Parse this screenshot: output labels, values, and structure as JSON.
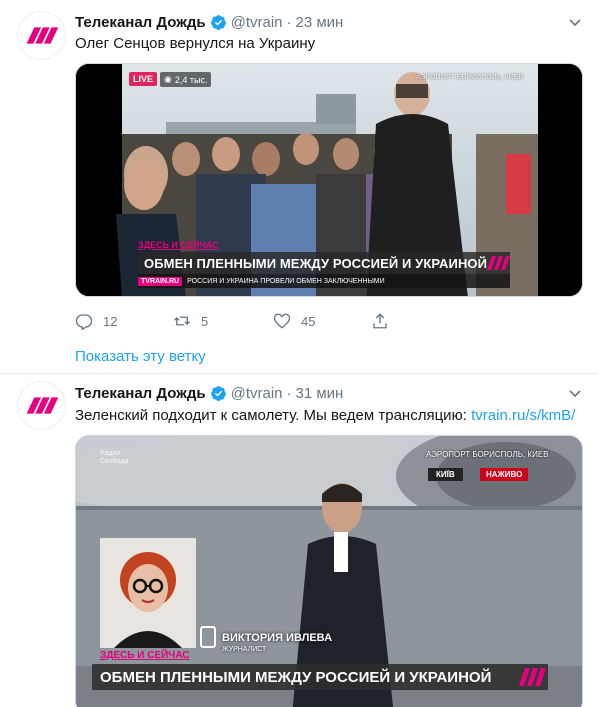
{
  "tweets": [
    {
      "author": "Телеканал Дождь",
      "handle": "@tvrain",
      "separator": "·",
      "time": "23 мин",
      "text": "Олег Сенцов вернулся на Украину",
      "media": {
        "live_badge": "LIVE",
        "viewers": "2,4 тыс.",
        "location": "АЭРОПОРТ БОРИСПОЛЬ, КИЕВ",
        "kicker": "ЗДЕСЬ И СЕЙЧАС",
        "headline": "ОБМЕН ПЛЕННЫМИ МЕЖДУ РОССИЕЙ И УКРАИНОЙ",
        "site": "TVRAIN.RU",
        "ticker": "РОССИЯ И УКРАИНА ПРОВЕЛИ ОБМЕН ЗАКЛЮЧЕННЫМИ"
      },
      "actions": {
        "replies": "12",
        "retweets": "5",
        "likes": "45"
      },
      "show_thread": "Показать эту ветку"
    },
    {
      "author": "Телеканал Дождь",
      "handle": "@tvrain",
      "separator": "·",
      "time": "31 мин",
      "text_prefix": "Зеленский подходит к самолету. Мы ведем трансляцию: ",
      "text_link": "tvrain.ru/s/kmB/",
      "media": {
        "source_logo": "Радио Свобода",
        "location": "АЭРОПОРТ БОРИСПОЛЬ, КИЕВ",
        "city": "КИЇВ",
        "live_ua": "НАЖИВО",
        "speaker_name": "ВИКТОРИЯ ИВЛЕВА",
        "speaker_role": "ЖУРНАЛИСТ",
        "kicker": "ЗДЕСЬ И СЕЙЧАС",
        "headline": "ОБМЕН ПЛЕННЫМИ МЕЖДУ РОССИЕЙ И УКРАИНОЙ"
      }
    }
  ],
  "colors": {
    "brand": "#e6007e",
    "link": "#1da1f2",
    "verified": "#1da1f2",
    "muted": "#657786"
  },
  "icons": [
    "reply-icon",
    "retweet-icon",
    "like-icon",
    "share-icon",
    "verified-icon",
    "chevron-down-icon",
    "tvrain-logo"
  ]
}
